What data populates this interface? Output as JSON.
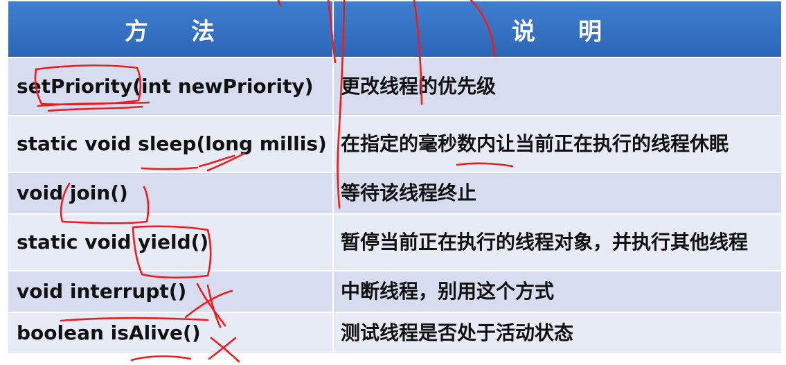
{
  "table": {
    "headers": {
      "method": [
        "方",
        "法"
      ],
      "description": [
        "说",
        "明"
      ]
    },
    "rows": [
      {
        "method": "setPriority(int  newPriority)",
        "description": "更改线程的优先级"
      },
      {
        "method": "static void sleep(long millis)",
        "description": "在指定的毫秒数内让当前正在执行的线程休眠"
      },
      {
        "method": "void join()",
        "description": "等待该线程终止"
      },
      {
        "method": "static void yield()",
        "description": "暂停当前正在执行的线程对象，并执行其他线程"
      },
      {
        "method": "void interrupt()",
        "description": "中断线程，别用这个方式"
      },
      {
        "method": "boolean isAlive()",
        "description": "测试线程是否处于活动状态"
      }
    ]
  },
  "colors": {
    "header_bg": "#3574c6",
    "row_bg_a": "#d7ddef",
    "row_bg_b": "#e7ebf6",
    "annotation_ink": "#ee1c1c"
  }
}
